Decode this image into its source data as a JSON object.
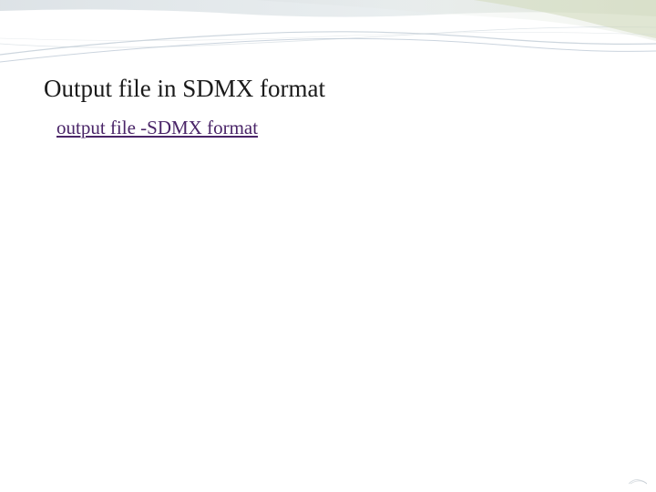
{
  "slide": {
    "title": "Output file in SDMX format",
    "link_text": "output file -SDMX format"
  }
}
